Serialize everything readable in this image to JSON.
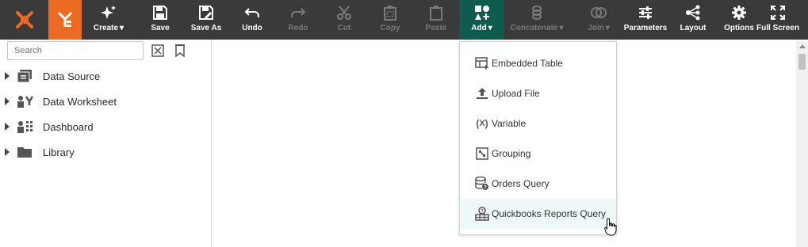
{
  "toolbar": {
    "buttons": [
      {
        "key": "create",
        "label": "Create",
        "has_caret": true,
        "enabled": true
      },
      {
        "key": "save",
        "label": "Save",
        "enabled": true
      },
      {
        "key": "save_as",
        "label": "Save As",
        "enabled": true
      },
      {
        "key": "undo",
        "label": "Undo",
        "enabled": true
      },
      {
        "key": "redo",
        "label": "Redo",
        "enabled": false
      },
      {
        "key": "cut",
        "label": "Cut",
        "enabled": false
      },
      {
        "key": "copy",
        "label": "Copy",
        "enabled": false
      },
      {
        "key": "paste",
        "label": "Paste",
        "enabled": false
      },
      {
        "key": "add",
        "label": "Add",
        "has_caret": true,
        "enabled": true,
        "active": true
      },
      {
        "key": "concatenate",
        "label": "Concatenate",
        "has_caret": true,
        "enabled": false
      },
      {
        "key": "join",
        "label": "Join",
        "has_caret": true,
        "enabled": false
      },
      {
        "key": "parameters",
        "label": "Parameters",
        "enabled": true
      },
      {
        "key": "layout",
        "label": "Layout",
        "enabled": true
      },
      {
        "key": "options",
        "label": "Options",
        "enabled": true
      },
      {
        "key": "full_screen",
        "label": "Full Screen",
        "enabled": true
      }
    ]
  },
  "sidebar": {
    "search_placeholder": "Search",
    "tree": [
      {
        "label": "Data Source",
        "icon": "data-source-icon"
      },
      {
        "label": "Data Worksheet",
        "icon": "data-worksheet-icon"
      },
      {
        "label": "Dashboard",
        "icon": "dashboard-icon"
      },
      {
        "label": "Library",
        "icon": "folder-icon"
      }
    ]
  },
  "add_menu": {
    "items": [
      {
        "label": "Embedded Table",
        "icon": "embedded-table-icon"
      },
      {
        "label": "Upload File",
        "icon": "upload-icon"
      },
      {
        "label": "Variable",
        "icon": "variable-icon"
      },
      {
        "label": "Grouping",
        "icon": "grouping-icon"
      },
      {
        "label": "Orders Query",
        "icon": "database-query-icon"
      },
      {
        "label": "Quickbooks Reports Query",
        "icon": "quickbooks-query-icon",
        "hovered": true
      }
    ]
  },
  "colors": {
    "toolbar_bg": "#3a3a3a",
    "brand_orange": "#ec6b22",
    "active_tab": "#0f5c4f",
    "hover_row": "#eef8f8"
  }
}
